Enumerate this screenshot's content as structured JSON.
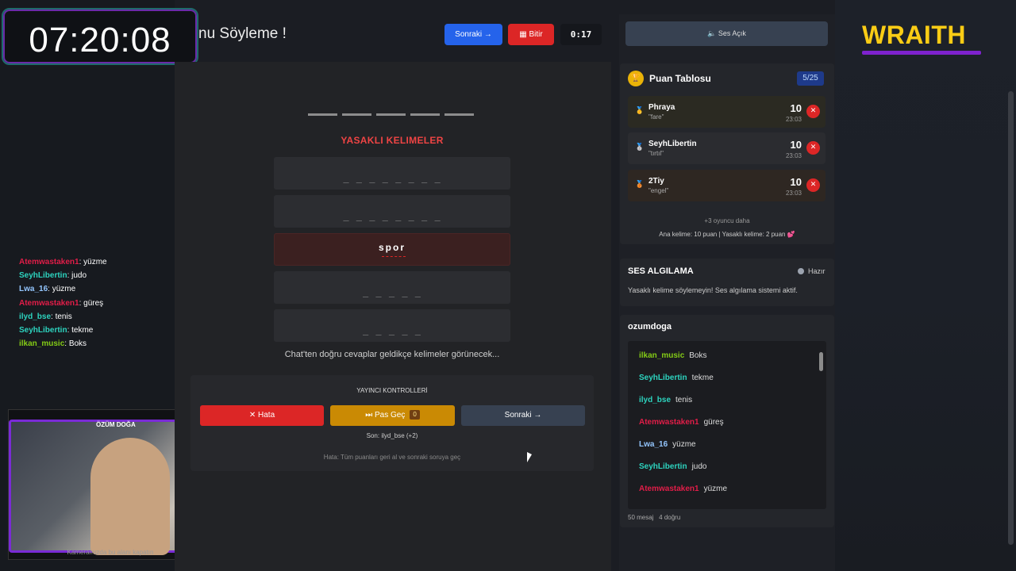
{
  "clock": "07:20:08",
  "title": "nu Söyleme !",
  "topbar": {
    "next_label": "Sonraki →",
    "finish_label": "Bitir",
    "timer": "0:17"
  },
  "game": {
    "forbidden_title": "YASAKLI KELIMELER",
    "words": [
      {
        "mask": "_ _ _ _ _ _ _ _",
        "revealed": false
      },
      {
        "mask": "_ _ _ _ _ _ _ _",
        "revealed": false
      },
      {
        "mask": "spor",
        "revealed": true
      },
      {
        "mask": "_ _ _ _ _",
        "revealed": false
      },
      {
        "mask": "_ _ _ _ _",
        "revealed": false
      }
    ],
    "hint": "Chat'ten doğru cevaplar geldikçe kelimeler görünecek..."
  },
  "controls": {
    "title": "YAYINCI KONTROLLERİ",
    "error_label": "Hata",
    "skip_label": "Pas Geç",
    "skip_count": "0",
    "next_label": "Sonraki →",
    "last": "Son: ilyd_bse (+2)",
    "error_note": "Hata: Tüm puanları geri al ve sonraki soruya geç"
  },
  "stream_chat": [
    {
      "user": "Atemwastaken1",
      "text": ": yüzme",
      "color": "#e11d48"
    },
    {
      "user": "SeyhLibertin",
      "text": ": judo",
      "color": "#2dd4bf"
    },
    {
      "user": "Lwa_16",
      "text": ": yüzme",
      "color": "#93c5fd"
    },
    {
      "user": "Atemwastaken1",
      "text": ": güreş",
      "color": "#e11d48"
    },
    {
      "user": "ilyd_bse",
      "text": ": tenis",
      "color": "#2dd4bf"
    },
    {
      "user": "SeyhLibertin",
      "text": ": tekme",
      "color": "#2dd4bf"
    },
    {
      "user": "ilkan_music",
      "text": ": Boks",
      "color": "#84cc16"
    }
  ],
  "webcam": {
    "name": "ÖZÜM DOĞA",
    "caption": "Kameramızda bu alanı kapatın"
  },
  "sound_button": "Ses Açık",
  "scoreboard": {
    "title": "Puan Tablosu",
    "count": "5/25",
    "players": [
      {
        "name": "Phraya",
        "word": "\"fare\"",
        "score": "10",
        "time": "23:03",
        "bg": "#2b2a22"
      },
      {
        "name": "SeyhLibertin",
        "word": "\"tırtıl\"",
        "score": "10",
        "time": "23:03",
        "bg": "#2b2c30"
      },
      {
        "name": "2Tiy",
        "word": "\"engel\"",
        "score": "10",
        "time": "23:03",
        "bg": "#2e2722"
      }
    ],
    "more": "+3 oyuncu daha",
    "rules": "Ana kelime: 10 puan | Yasaklı kelime: 2 puan"
  },
  "voice": {
    "title": "SES ALGILAMA",
    "status": "Hazır",
    "desc": "Yasaklı kelime söylemeyin! Ses algılama sistemi aktif."
  },
  "chat": {
    "owner": "ozumdoga",
    "messages": [
      {
        "user": "ilkan_music",
        "text": "Boks",
        "color": "#84cc16"
      },
      {
        "user": "SeyhLibertin",
        "text": "tekme",
        "color": "#2dd4bf"
      },
      {
        "user": "ilyd_bse",
        "text": "tenis",
        "color": "#2dd4bf"
      },
      {
        "user": "Atemwastaken1",
        "text": "güreş",
        "color": "#e11d48"
      },
      {
        "user": "Lwa_16",
        "text": "yüzme",
        "color": "#93c5fd"
      },
      {
        "user": "SeyhLibertin",
        "text": "judo",
        "color": "#2dd4bf"
      },
      {
        "user": "Atemwastaken1",
        "text": "yüzme",
        "color": "#e11d48"
      }
    ],
    "footer_count": "50 mesaj",
    "footer_correct": "4 doğru"
  },
  "logo": "WRAITH",
  "colors": {
    "accent_red": "#dc2626",
    "accent_blue": "#2563eb",
    "accent_yellow": "#ca8a04",
    "logo": "#facc15"
  }
}
